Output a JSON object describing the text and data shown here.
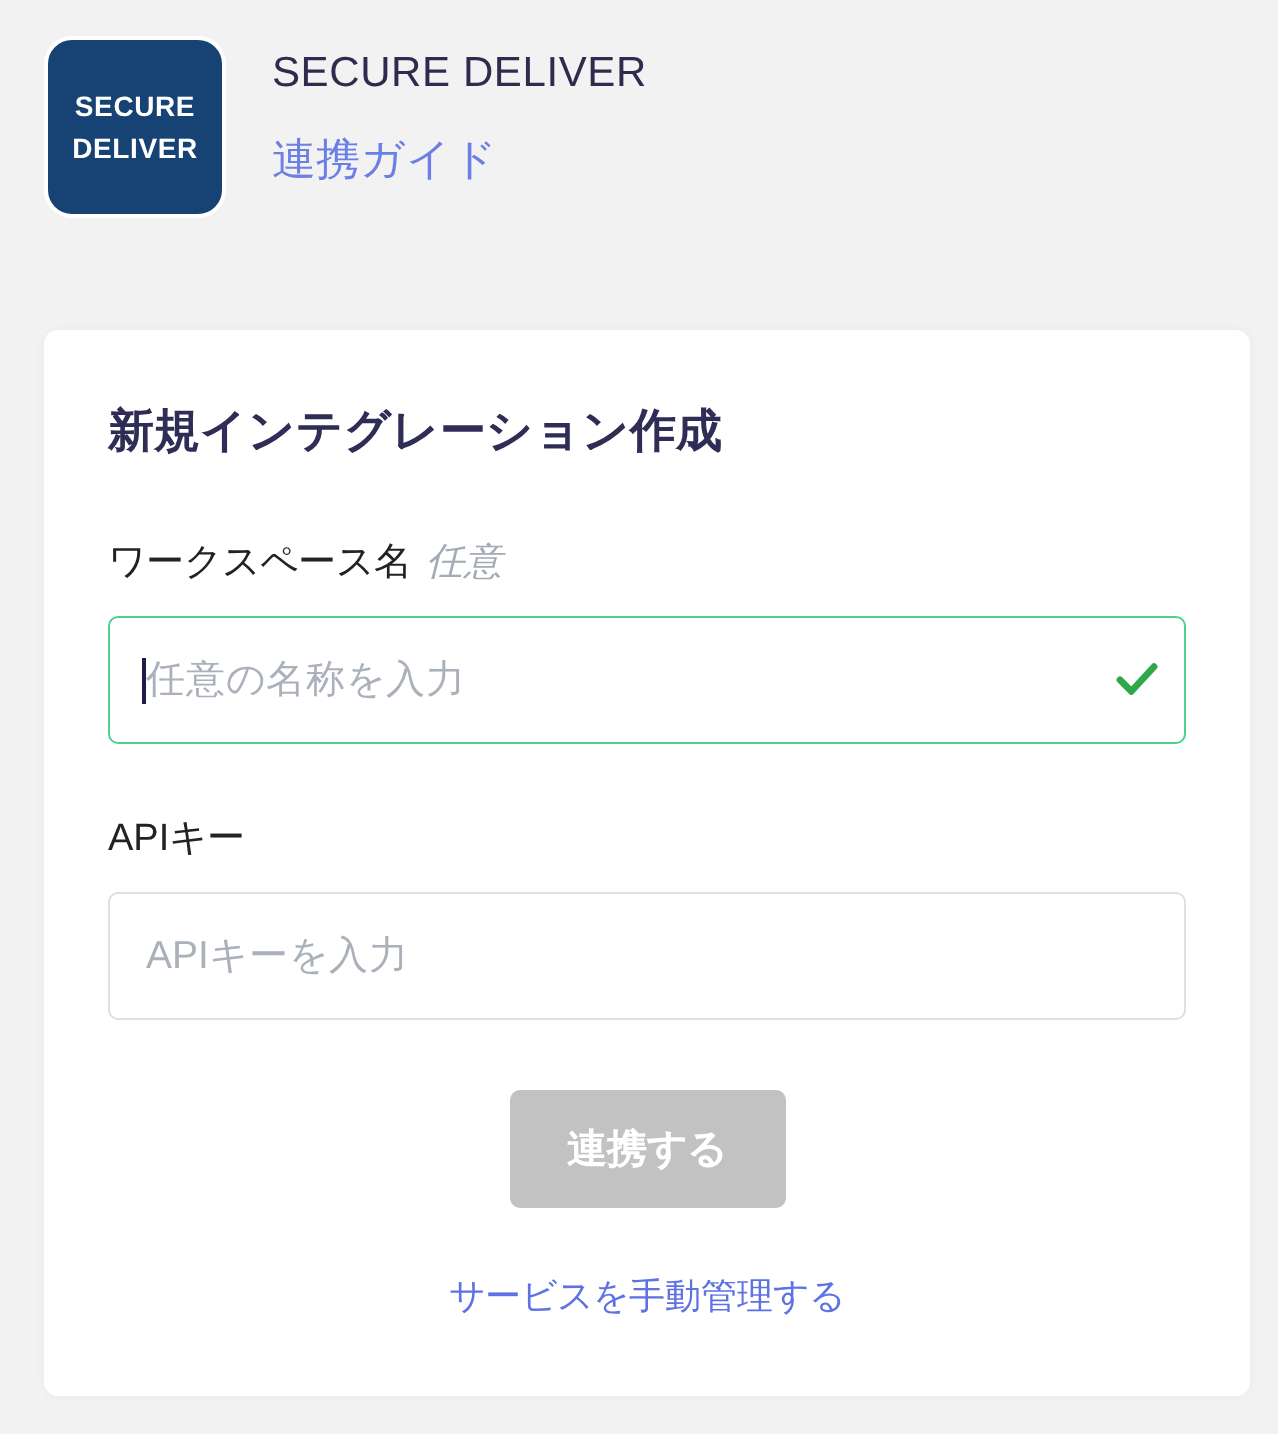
{
  "app": {
    "logo_lines": [
      "SECURE",
      "DELIVER"
    ],
    "name": "SECURE DELIVER",
    "guide_link": "連携ガイド"
  },
  "form": {
    "title": "新規インテグレーション作成",
    "fields": [
      {
        "label": "ワークスペース名",
        "optional_tag": "任意",
        "placeholder": "任意の名称を入力",
        "focused": true,
        "valid": true
      },
      {
        "label": "APIキー",
        "placeholder": "APIキーを入力",
        "focused": false,
        "valid": false
      }
    ],
    "submit": {
      "label": "連携する",
      "disabled": true
    },
    "manual_link": "サービスを手動管理する"
  }
}
